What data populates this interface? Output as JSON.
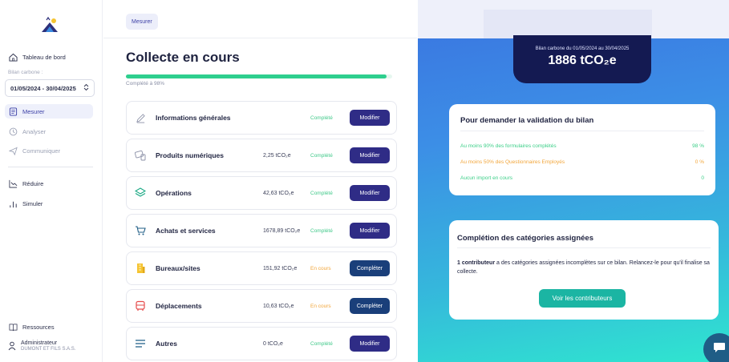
{
  "sidebar": {
    "nav_top": [
      {
        "label": "Tableau de bord",
        "icon": "home-icon"
      }
    ],
    "period": {
      "label": "Bilan carbone :",
      "value": "01/05/2024 - 30/04/2025"
    },
    "nav_steps": [
      {
        "label": "Mesurer",
        "icon": "list-icon",
        "active": true
      },
      {
        "label": "Analyser",
        "icon": "clock-icon",
        "active": false
      },
      {
        "label": "Communiquer",
        "icon": "send-icon",
        "active": false
      }
    ],
    "nav_actions": [
      {
        "label": "Réduire",
        "icon": "trend-down-icon"
      },
      {
        "label": "Simuler",
        "icon": "bar-chart-icon"
      }
    ],
    "resources": "Ressources",
    "user": {
      "role": "Administrateur",
      "company": "DUMONT ET FILS S.A.S."
    }
  },
  "breadcrumb": "Mesurer",
  "main": {
    "title": "Collecte en cours",
    "progress_percent": 98,
    "progress_text": "Complété à 98%",
    "rows": [
      {
        "title": "Informations générales",
        "value": "",
        "status": "Complété",
        "status_type": "done",
        "action": "Modifier",
        "icon": "pen-icon"
      },
      {
        "title": "Produits numériques",
        "value": "2,25 tCO₂e",
        "status": "Complété",
        "status_type": "done",
        "action": "Modifier",
        "icon": "devices-icon"
      },
      {
        "title": "Opérations",
        "value": "42,63 tCO₂e",
        "status": "Complété",
        "status_type": "done",
        "action": "Modifier",
        "icon": "layers-icon"
      },
      {
        "title": "Achats et services",
        "value": "1678,89 tCO₂e",
        "status": "Complété",
        "status_type": "done",
        "action": "Modifier",
        "icon": "cart-icon"
      },
      {
        "title": "Bureaux/sites",
        "value": "151,92 tCO₂e",
        "status": "En cours",
        "status_type": "prog",
        "action": "Compléter",
        "icon": "building-icon"
      },
      {
        "title": "Déplacements",
        "value": "10,63 tCO₂e",
        "status": "En cours",
        "status_type": "prog",
        "action": "Compléter",
        "icon": "bus-icon"
      },
      {
        "title": "Autres",
        "value": "0 tCO₂e",
        "status": "Complété",
        "status_type": "done",
        "action": "Modifier",
        "icon": "menu-icon"
      }
    ]
  },
  "summary": {
    "label": "Bilan carbone du 01/05/2024 au 30/04/2025",
    "value": "1886 tCO₂e"
  },
  "validation": {
    "title": "Pour demander la validation du bilan",
    "criteria": [
      {
        "text": "Au moins 90% des formulaires complétés",
        "value": "98 %",
        "color": "green"
      },
      {
        "text": "Au moins 50% des Questionnaires Employés",
        "value": "0 %",
        "color": "orange"
      },
      {
        "text": "Aucun import en cours",
        "value": "0",
        "color": "green"
      }
    ]
  },
  "categories": {
    "title": "Complétion des catégories assignées",
    "desc_bold": "1 contributeur",
    "desc_rest": " a des catégories assignées incomplètes sur ce bilan. Relancez-le pour qu'il finalise sa collecte.",
    "button": "Voir les contributeurs"
  },
  "colors": {
    "accent": "#2f2c86",
    "success": "#2ecf8e",
    "warning": "#f2a63b",
    "teal_button": "#1bb5a3",
    "summary_box": "#141a52"
  }
}
